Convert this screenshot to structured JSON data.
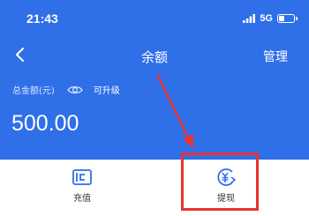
{
  "status_bar": {
    "time": "21:43",
    "network": "5G"
  },
  "nav": {
    "back_icon": "chevron-left-icon",
    "title": "余额",
    "manage_label": "管理"
  },
  "balance": {
    "total_label": "总金额(元)",
    "eye_icon": "eye-icon",
    "upgrade_label": "可升级",
    "amount": "500.00"
  },
  "actions": [
    {
      "label": "充值",
      "icon": "wallet-icon"
    },
    {
      "label": "提现",
      "icon": "yuan-withdraw-icon"
    }
  ],
  "colors": {
    "header_bg": "#2f6fe8",
    "accent": "#2f6fe8",
    "annotation": "#e8332f"
  }
}
